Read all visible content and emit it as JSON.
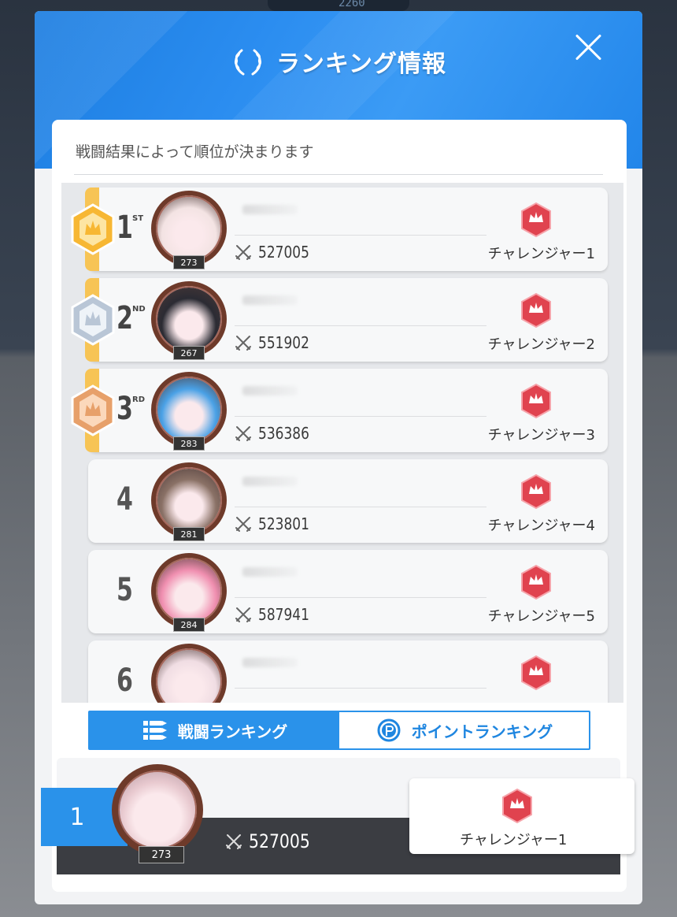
{
  "modal": {
    "title": "ランキング情報",
    "subtitle": "戦闘結果によって順位が決まります"
  },
  "background": {
    "top_value": "2260"
  },
  "rows": [
    {
      "rank": "1",
      "suffix": "ST",
      "medal": "gold",
      "level": "273",
      "power": "527005",
      "tier": "チャレンジャー1",
      "face_color": "#f3e3e3"
    },
    {
      "rank": "2",
      "suffix": "ND",
      "medal": "silver",
      "level": "267",
      "power": "551902",
      "tier": "チャレンジャー2",
      "face_color": "#2b2b33"
    },
    {
      "rank": "3",
      "suffix": "RD",
      "medal": "bronze",
      "level": "283",
      "power": "536386",
      "tier": "チャレンジャー3",
      "face_color": "#4aa1e6"
    },
    {
      "rank": "4",
      "suffix": "",
      "medal": "",
      "level": "281",
      "power": "523801",
      "tier": "チャレンジャー4",
      "face_color": "#8a7166"
    },
    {
      "rank": "5",
      "suffix": "",
      "medal": "",
      "level": "284",
      "power": "587941",
      "tier": "チャレンジャー5",
      "face_color": "#f08fb0"
    },
    {
      "rank": "6",
      "suffix": "",
      "medal": "",
      "level": "",
      "power": "",
      "tier": "",
      "face_color": "#f0dde3"
    }
  ],
  "tabs": {
    "battle_label": "戦闘ランキング",
    "point_label": "ポイントランキング"
  },
  "my_rank": {
    "rank": "1",
    "level": "273",
    "power": "527005",
    "tier": "チャレンジャー1"
  },
  "colors": {
    "accent_blue": "#2a92ea",
    "gold": "#f7c455",
    "tier_red": "#e0434f"
  },
  "icons": {
    "title": "laurel-icon",
    "close": "close-icon",
    "power": "crossed-swords-icon",
    "tier": "crown-tier-icon",
    "battle_tab": "ammo-icon",
    "point_tab": "p-coin-icon"
  }
}
